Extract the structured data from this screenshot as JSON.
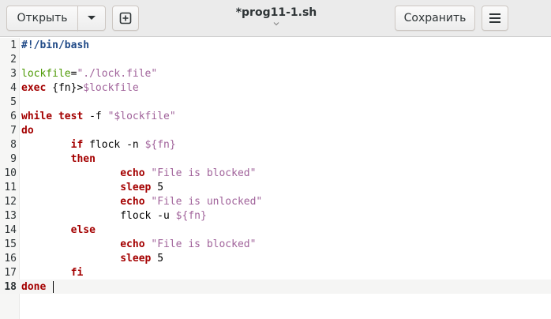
{
  "header": {
    "open_label": "Открыть",
    "save_label": "Сохранить",
    "title": "*prog11-1.sh"
  },
  "editor": {
    "current_line": 18,
    "lines": [
      {
        "num": "1",
        "tokens": [
          {
            "t": "#!/bin/bash",
            "c": "sh"
          }
        ]
      },
      {
        "num": "2",
        "tokens": []
      },
      {
        "num": "3",
        "tokens": [
          {
            "t": "lockfile",
            "c": "idt"
          },
          {
            "t": "=",
            "c": ""
          },
          {
            "t": "\"./lock.file\"",
            "c": "str"
          }
        ]
      },
      {
        "num": "4",
        "tokens": [
          {
            "t": "exec",
            "c": "kw"
          },
          {
            "t": " {fn}>",
            "c": ""
          },
          {
            "t": "$lockfile",
            "c": "var"
          }
        ]
      },
      {
        "num": "5",
        "tokens": []
      },
      {
        "num": "6",
        "tokens": [
          {
            "t": "while",
            "c": "kw"
          },
          {
            "t": " ",
            "c": ""
          },
          {
            "t": "test",
            "c": "kw"
          },
          {
            "t": " -f ",
            "c": ""
          },
          {
            "t": "\"$lockfile\"",
            "c": "str"
          }
        ]
      },
      {
        "num": "7",
        "tokens": [
          {
            "t": "do",
            "c": "kw"
          }
        ]
      },
      {
        "num": "8",
        "tokens": [
          {
            "t": "        ",
            "c": ""
          },
          {
            "t": "if",
            "c": "kw"
          },
          {
            "t": " flock -n ",
            "c": ""
          },
          {
            "t": "${fn}",
            "c": "var"
          }
        ]
      },
      {
        "num": "9",
        "tokens": [
          {
            "t": "        ",
            "c": ""
          },
          {
            "t": "then",
            "c": "kw"
          }
        ]
      },
      {
        "num": "10",
        "tokens": [
          {
            "t": "                ",
            "c": ""
          },
          {
            "t": "echo",
            "c": "kw"
          },
          {
            "t": " ",
            "c": ""
          },
          {
            "t": "\"File is blocked\"",
            "c": "str"
          }
        ]
      },
      {
        "num": "11",
        "tokens": [
          {
            "t": "                ",
            "c": ""
          },
          {
            "t": "sleep",
            "c": "kw"
          },
          {
            "t": " 5",
            "c": ""
          }
        ]
      },
      {
        "num": "12",
        "tokens": [
          {
            "t": "                ",
            "c": ""
          },
          {
            "t": "echo",
            "c": "kw"
          },
          {
            "t": " ",
            "c": ""
          },
          {
            "t": "\"File is unlocked\"",
            "c": "str"
          }
        ]
      },
      {
        "num": "13",
        "tokens": [
          {
            "t": "                flock -u ",
            "c": ""
          },
          {
            "t": "${fn}",
            "c": "var"
          }
        ]
      },
      {
        "num": "14",
        "tokens": [
          {
            "t": "        ",
            "c": ""
          },
          {
            "t": "else",
            "c": "kw"
          }
        ]
      },
      {
        "num": "15",
        "tokens": [
          {
            "t": "                ",
            "c": ""
          },
          {
            "t": "echo",
            "c": "kw"
          },
          {
            "t": " ",
            "c": ""
          },
          {
            "t": "\"File is blocked\"",
            "c": "str"
          }
        ]
      },
      {
        "num": "16",
        "tokens": [
          {
            "t": "                ",
            "c": ""
          },
          {
            "t": "sleep",
            "c": "kw"
          },
          {
            "t": " 5",
            "c": ""
          }
        ]
      },
      {
        "num": "17",
        "tokens": [
          {
            "t": "        ",
            "c": ""
          },
          {
            "t": "fi",
            "c": "kw"
          }
        ]
      },
      {
        "num": "18",
        "tokens": [
          {
            "t": "done",
            "c": "kw"
          },
          {
            "t": " ",
            "c": ""
          }
        ]
      }
    ]
  },
  "colors": {
    "keyword": "#a40000",
    "string": "#a0629a",
    "shebang": "#204a87",
    "identifier": "#4e9a06"
  }
}
